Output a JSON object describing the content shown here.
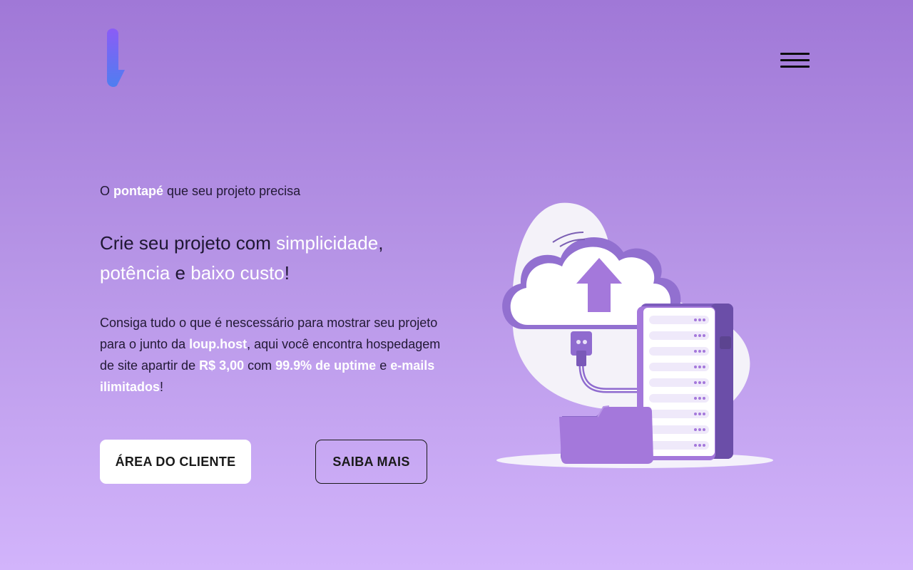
{
  "header": {
    "logo_icon": "loup-logo-icon",
    "menu_icon": "hamburger-menu-icon"
  },
  "hero": {
    "tagline": {
      "before": "O ",
      "highlight": "pontapé",
      "after": " que seu projeto precisa"
    },
    "headline": {
      "part1": "Crie seu projeto com ",
      "hl1": "simplicidade",
      "part2": ",",
      "hl2": "potência",
      "part3": " e ",
      "hl3": "baixo custo",
      "part4": "!"
    },
    "description": {
      "t1": "Consiga tudo o que é nescessário para mostrar seu projeto para o junto da ",
      "brand": "loup.host",
      "t2": ", aqui você encontra hospedagem de site apartir de ",
      "price": "R$ 3,00",
      "t3": " com ",
      "uptime": "99.9% de uptime",
      "t4": " e ",
      "emails": "e-mails ilimitados",
      "t5": "!"
    }
  },
  "buttons": {
    "client_area": "ÁREA DO CLIENTE",
    "learn_more": "SAIBA MAIS"
  },
  "illustration": {
    "icon": "cloud-upload-server-illustration"
  },
  "colors": {
    "background_top": "#a078d7",
    "background_bottom": "#d2b4fb",
    "accent_purple": "#a478db",
    "highlight_text": "#ffffff",
    "logo_gradient_start": "#8b5cf6",
    "logo_gradient_end": "#4f7ef0"
  }
}
